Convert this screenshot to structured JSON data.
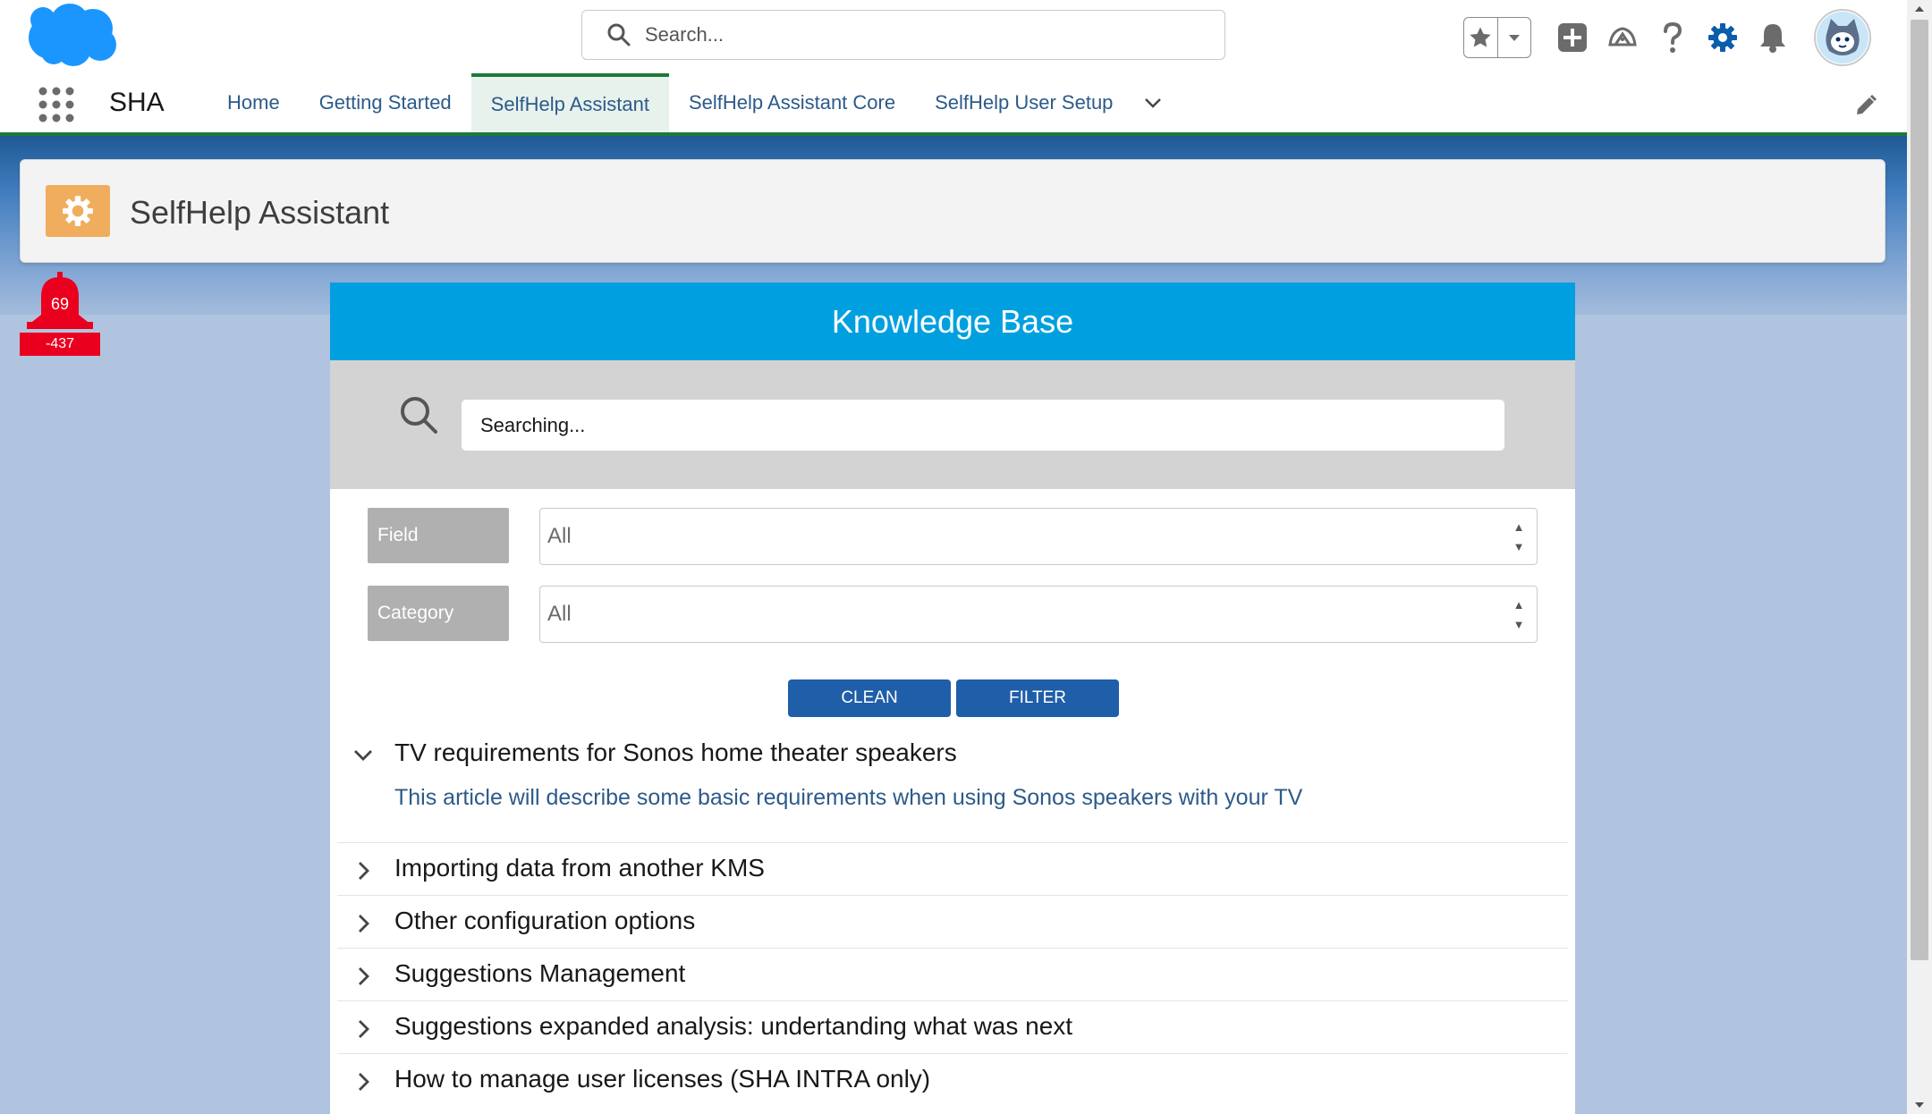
{
  "header": {
    "search_placeholder": "Search...",
    "brand_color": "#1b96ff"
  },
  "nav": {
    "app_name": "SHA",
    "tabs": [
      {
        "label": "Home",
        "active": false
      },
      {
        "label": "Getting Started",
        "active": false
      },
      {
        "label": "SelfHelp Assistant",
        "active": true
      },
      {
        "label": "SelfHelp Assistant Core",
        "active": false
      },
      {
        "label": "SelfHelp User Setup",
        "active": false
      }
    ]
  },
  "page": {
    "title": "SelfHelp Assistant",
    "icon": "gear-icon",
    "icon_color": "#f0ad5d"
  },
  "bell": {
    "count": "69",
    "sub": "-437",
    "color": "#ea001e"
  },
  "kb": {
    "title": "Knowledge Base",
    "header_color": "#00a0e0",
    "search_value": "Searching...",
    "filters": [
      {
        "label": "Field",
        "value": "All"
      },
      {
        "label": "Category",
        "value": "All"
      }
    ],
    "clean_label": "CLEAN",
    "filter_label": "FILTER",
    "articles": [
      {
        "title": "TV requirements for Sonos home theater speakers",
        "expanded": true,
        "description": "This article will describe some basic requirements when using Sonos speakers with your TV"
      },
      {
        "title": "Importing data from another KMS",
        "expanded": false
      },
      {
        "title": "Other configuration options",
        "expanded": false
      },
      {
        "title": "Suggestions Management",
        "expanded": false
      },
      {
        "title": "Suggestions expanded analysis: undertanding what was next",
        "expanded": false
      },
      {
        "title": "How to manage user licenses (SHA INTRA only)",
        "expanded": false
      }
    ]
  }
}
